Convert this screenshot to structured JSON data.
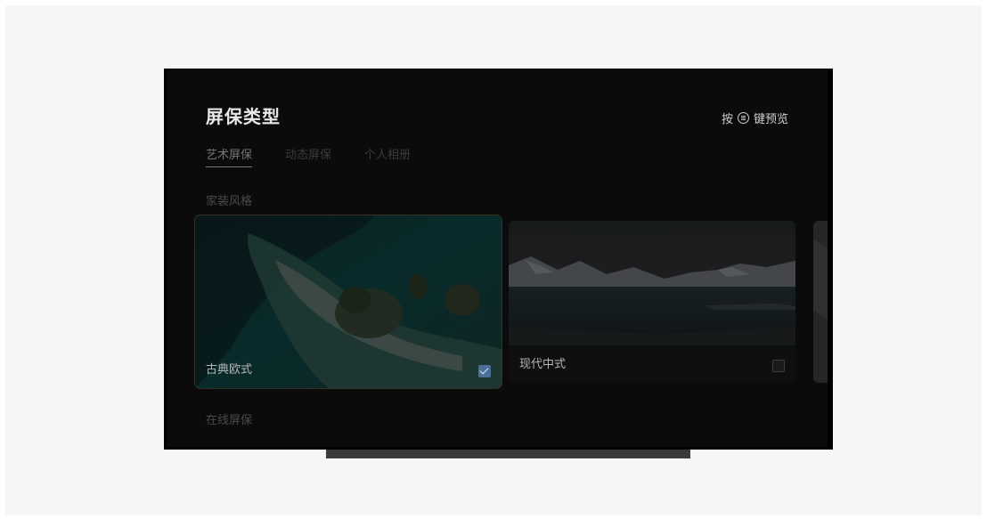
{
  "header": {
    "title": "屏保类型",
    "hint_prefix": "按",
    "hint_icon": "menu-key-icon",
    "hint_suffix": "键预览"
  },
  "tabs": [
    {
      "label": "艺术屏保",
      "active": true
    },
    {
      "label": "动态屏保",
      "active": false
    },
    {
      "label": "个人相册",
      "active": false
    }
  ],
  "sections": {
    "home_style": "家装风格",
    "online": "在线屏保"
  },
  "cards": [
    {
      "label": "古典欧式",
      "checked": true
    },
    {
      "label": "现代中式",
      "checked": false
    }
  ],
  "colors": {
    "screen_bg": "#0b0b0c",
    "check_accent": "#4a6f99"
  }
}
